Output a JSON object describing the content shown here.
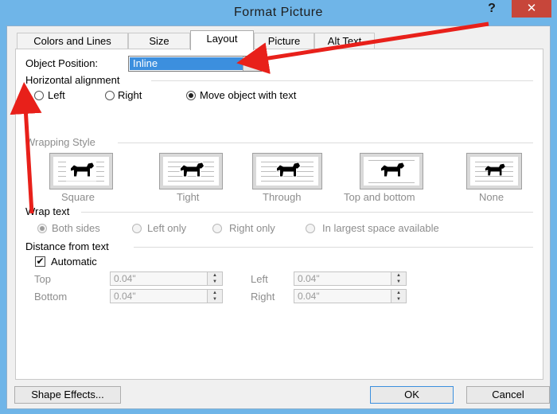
{
  "window": {
    "title": "Format Picture",
    "help_label": "?",
    "close_label": "✕"
  },
  "tabs": [
    {
      "label": "Colors and Lines"
    },
    {
      "label": "Size"
    },
    {
      "label": "Layout",
      "active": true
    },
    {
      "label": "Picture"
    },
    {
      "label": "Alt Text"
    }
  ],
  "layout": {
    "object_position_label": "Object Position:",
    "object_position_value": "Inline",
    "horizontal_alignment_label": "Horizontal alignment",
    "alignment_options": [
      "Left",
      "Right",
      "Move object with text"
    ],
    "alignment_selected": "Move object with text",
    "wrapping_style_label": "Wrapping Style",
    "wrapping_styles": [
      "Square",
      "Tight",
      "Through",
      "Top and bottom",
      "None"
    ],
    "wrap_text_label": "Wrap text",
    "wrap_text_options": [
      "Both sides",
      "Left only",
      "Right only",
      "In largest space available"
    ],
    "wrap_text_selected": "Both sides",
    "distance_label": "Distance from text",
    "automatic_label": "Automatic",
    "automatic_checked": true,
    "distance_fields": {
      "top_label": "Top",
      "top_value": "0.04\"",
      "left_label": "Left",
      "left_value": "0.04\"",
      "bottom_label": "Bottom",
      "bottom_value": "0.04\"",
      "right_label": "Right",
      "right_value": "0.04\""
    }
  },
  "footer": {
    "shape_effects_label": "Shape Effects...",
    "ok_label": "OK",
    "cancel_label": "Cancel"
  },
  "colors": {
    "titlebar": "#6fb5e8",
    "close_button": "#c7463a",
    "selection": "#3c8fde",
    "annotation_arrow": "#e8201a"
  },
  "icons": {
    "wrap_preview": "dog-silhouette-icon",
    "spin_up": "spin-up-icon",
    "spin_down": "spin-down-icon",
    "dropdown": "chevron-down-icon",
    "check": "checkmark-icon"
  }
}
